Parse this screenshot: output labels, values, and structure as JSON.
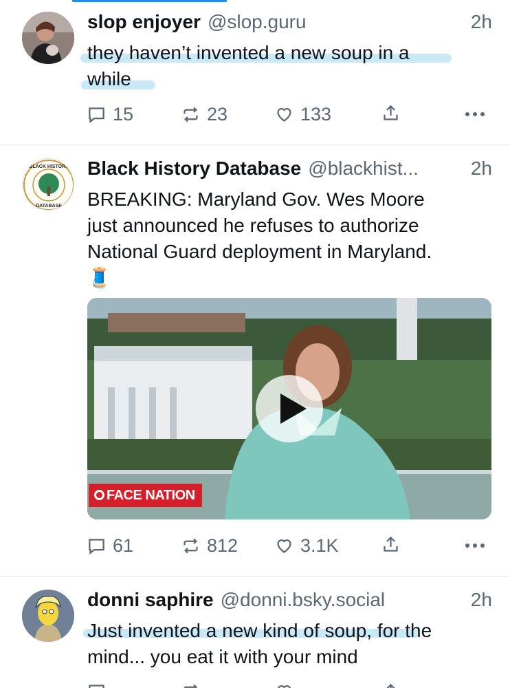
{
  "posts": [
    {
      "author": "slop enjoyer",
      "handle": "@slop.guru",
      "time": "2h",
      "text_lines": [
        "they haven’t invented a new soup in a",
        "while"
      ],
      "replies": "15",
      "reposts": "23",
      "likes": "133"
    },
    {
      "author": "Black History Database",
      "handle": "@blackhist...",
      "time": "2h",
      "text_lines": [
        "BREAKING: Maryland Gov. Wes Moore",
        "just announced he refuses to authorize",
        "National Guard deployment in Maryland.",
        "🧵"
      ],
      "avatar_text": {
        "top": "BLACK HISTORY",
        "bottom": "DATABASE"
      },
      "video_badge": "FACE NATION",
      "replies": "61",
      "reposts": "812",
      "likes": "3.1K"
    },
    {
      "author": "donni saphire",
      "handle": "@donni.bsky.social",
      "time": "2h",
      "text_lines": [
        "Just invented a new kind of soup, for the",
        "mind... you eat it with your mind"
      ]
    }
  ],
  "colors": {
    "accent": "#1d8cf0",
    "highlight": "#9fd7f0",
    "secondary_text": "#5b6773",
    "divider": "#e3e8ed"
  },
  "icons": [
    "reply-icon",
    "repost-icon",
    "like-icon",
    "share-icon",
    "more-icon",
    "play-icon"
  ]
}
